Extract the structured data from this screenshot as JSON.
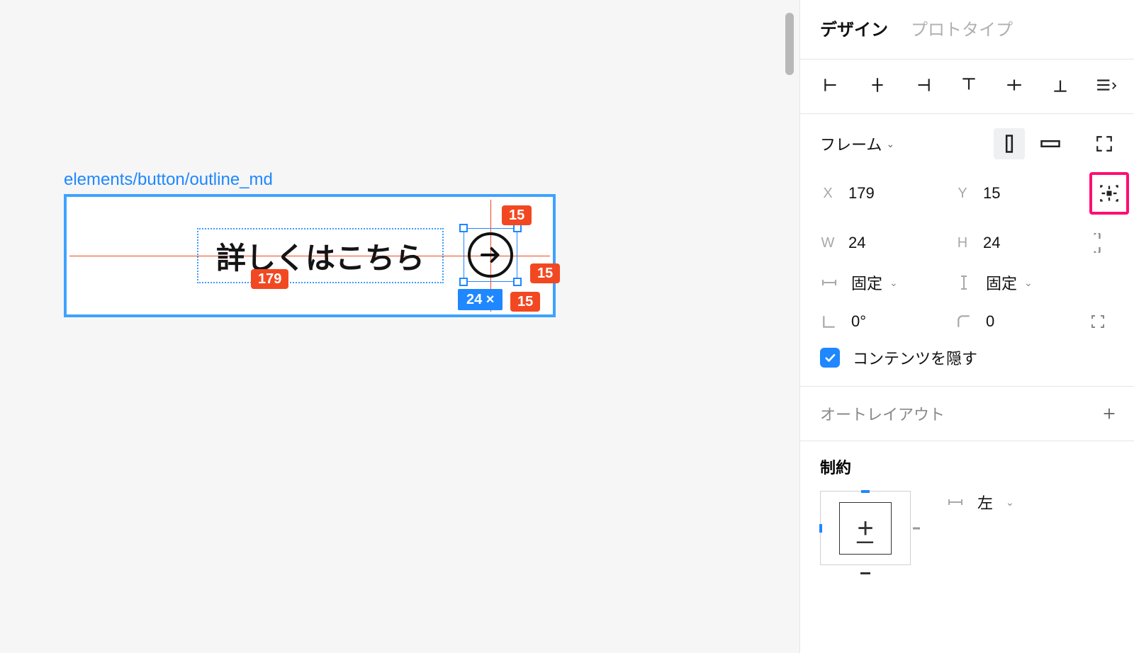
{
  "canvas": {
    "frame_label": "elements/button/outline_md",
    "button_text": "詳しくはこちら",
    "measure_left": "179",
    "measure_top": "15",
    "measure_right": "15",
    "measure_bottom": "15",
    "selection_size": "24 ×"
  },
  "panel": {
    "tabs": {
      "design": "デザイン",
      "prototype": "プロトタイプ"
    },
    "frame_section": {
      "title": "フレーム",
      "x_label": "X",
      "x_value": "179",
      "y_label": "Y",
      "y_value": "15",
      "w_label": "W",
      "w_value": "24",
      "h_label": "H",
      "h_value": "24",
      "horiz_resize": "固定",
      "vert_resize": "固定",
      "rotation": "0°",
      "corner": "0"
    },
    "clip_content": {
      "label": "コンテンツを隠す",
      "checked": true
    },
    "auto_layout": {
      "title": "オートレイアウト"
    },
    "constraints": {
      "title": "制約",
      "horiz": "左"
    }
  }
}
